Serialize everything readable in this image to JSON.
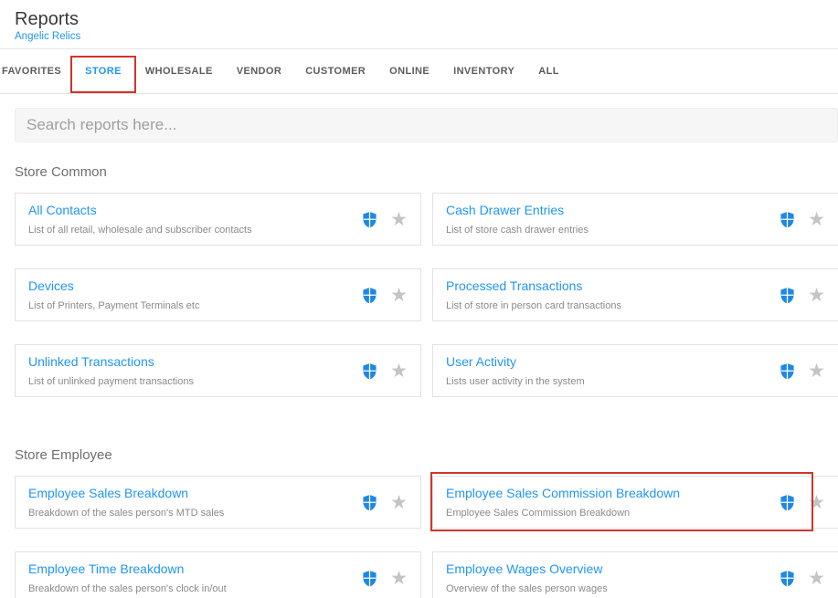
{
  "header": {
    "title": "Reports",
    "subtitle": "Angelic Relics"
  },
  "tabs": [
    {
      "label": "FAVORITES",
      "active": false,
      "annotated": false
    },
    {
      "label": "STORE",
      "active": true,
      "annotated": true
    },
    {
      "label": "WHOLESALE",
      "active": false,
      "annotated": false
    },
    {
      "label": "VENDOR",
      "active": false,
      "annotated": false
    },
    {
      "label": "CUSTOMER",
      "active": false,
      "annotated": false
    },
    {
      "label": "ONLINE",
      "active": false,
      "annotated": false
    },
    {
      "label": "INVENTORY",
      "active": false,
      "annotated": false
    },
    {
      "label": "ALL",
      "active": false,
      "annotated": false
    }
  ],
  "search": {
    "placeholder": "Search reports here..."
  },
  "sections": [
    {
      "title": "Store Common",
      "reports": [
        {
          "title": "All Contacts",
          "description": "List of all retail, wholesale and subscriber contacts",
          "annotated": false
        },
        {
          "title": "Cash Drawer Entries",
          "description": "List of store cash drawer entries",
          "annotated": false
        },
        {
          "title": "Devices",
          "description": "List of Printers, Payment Terminals etc",
          "annotated": false
        },
        {
          "title": "Processed Transactions",
          "description": "List of store in person card transactions",
          "annotated": false
        },
        {
          "title": "Unlinked Transactions",
          "description": "List of unlinked payment transactions",
          "annotated": false
        },
        {
          "title": "User Activity",
          "description": "Lists user activity in the system",
          "annotated": false
        }
      ]
    },
    {
      "title": "Store Employee",
      "reports": [
        {
          "title": "Employee Sales Breakdown",
          "description": "Breakdown of the sales person's MTD sales",
          "annotated": false
        },
        {
          "title": "Employee Sales Commission Breakdown",
          "description": "Employee Sales Commission Breakdown",
          "annotated": true
        },
        {
          "title": "Employee Time Breakdown",
          "description": "Breakdown of the sales person's clock in/out",
          "annotated": false
        },
        {
          "title": "Employee Wages Overview",
          "description": "Overview of the sales person wages",
          "annotated": false
        }
      ]
    }
  ],
  "icons": {
    "shield": "shield-icon",
    "star": "star-icon"
  },
  "colors": {
    "accent": "#2196f3",
    "annotation": "#d0342c",
    "shield": "#1e88e5",
    "star": "#c4c4c4"
  }
}
